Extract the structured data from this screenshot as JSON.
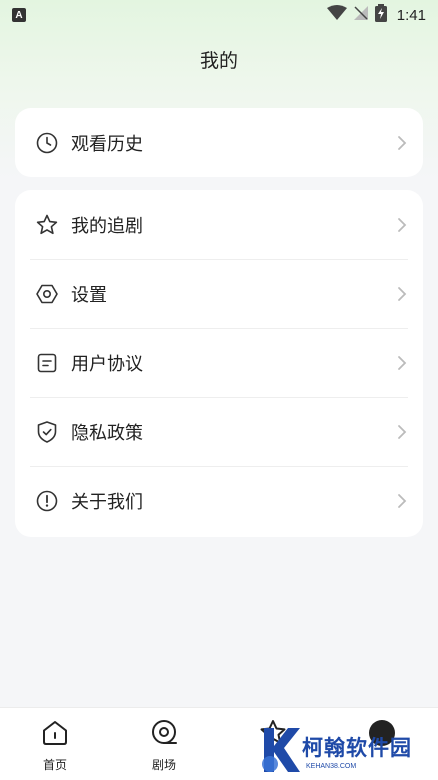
{
  "status_bar": {
    "notification_badge": "A",
    "time": "1:41"
  },
  "page": {
    "title": "我的"
  },
  "card1": {
    "items": [
      {
        "label": "观看历史",
        "icon": "clock-icon"
      }
    ]
  },
  "card2": {
    "items": [
      {
        "label": "我的追剧",
        "icon": "star-icon"
      },
      {
        "label": "设置",
        "icon": "hexagon-settings-icon"
      },
      {
        "label": "用户协议",
        "icon": "document-icon"
      },
      {
        "label": "隐私政策",
        "icon": "shield-check-icon"
      },
      {
        "label": "关于我们",
        "icon": "info-exclamation-icon"
      }
    ]
  },
  "tabbar": {
    "tabs": [
      {
        "label": "首页",
        "icon": "home-icon"
      },
      {
        "label": "剧场",
        "icon": "film-reel-icon"
      },
      {
        "label": "",
        "icon": "star-icon"
      },
      {
        "label": "",
        "icon": "profile-icon"
      }
    ]
  },
  "watermark": {
    "text": "柯翰软件园",
    "sub": "KEHAN38.COM"
  },
  "colors": {
    "accent_gradient": "#e3f5e0",
    "background": "#f5f6f8",
    "watermark": "#1f4aa8"
  }
}
